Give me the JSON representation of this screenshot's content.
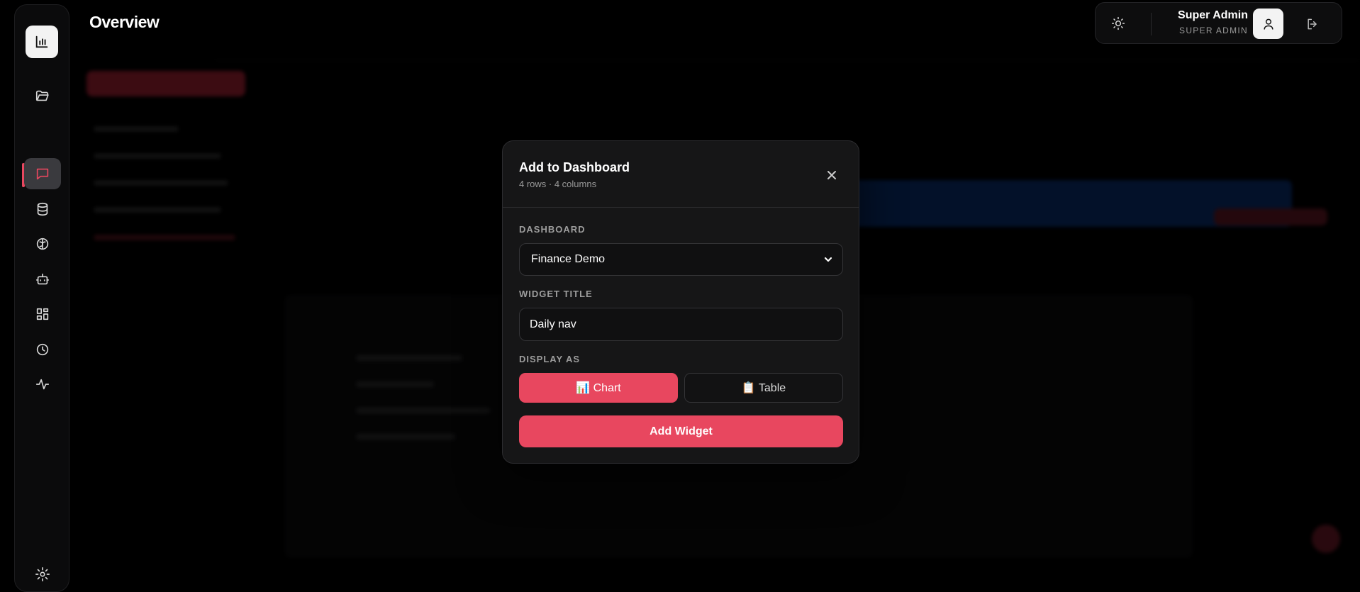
{
  "header": {
    "title": "Overview"
  },
  "user": {
    "name": "Super Admin",
    "role": "SUPER ADMIN"
  },
  "sidebar": {
    "items": [
      {
        "icon": "bar-chart-icon"
      },
      {
        "icon": "folder-open-icon"
      },
      {
        "icon": "chat-icon",
        "active": true
      },
      {
        "icon": "database-icon"
      },
      {
        "icon": "brain-icon"
      },
      {
        "icon": "bot-icon"
      },
      {
        "icon": "dashboard-grid-icon"
      },
      {
        "icon": "clock-icon"
      },
      {
        "icon": "activity-icon"
      },
      {
        "icon": "settings-icon"
      }
    ]
  },
  "modal": {
    "title": "Add to Dashboard",
    "subtitle": "4 rows · 4 columns",
    "dashboard_label": "DASHBOARD",
    "dashboard_value": "Finance Demo",
    "widget_title_label": "WIDGET TITLE",
    "widget_title_value": "Daily nav",
    "display_as_label": "DISPLAY AS",
    "chart_option": "📊 Chart",
    "table_option": "📋 Table",
    "selected_display": "Chart",
    "submit_label": "Add Widget"
  },
  "colors": {
    "accent": "#e8475f",
    "background": "#000000",
    "panel": "#161617"
  }
}
